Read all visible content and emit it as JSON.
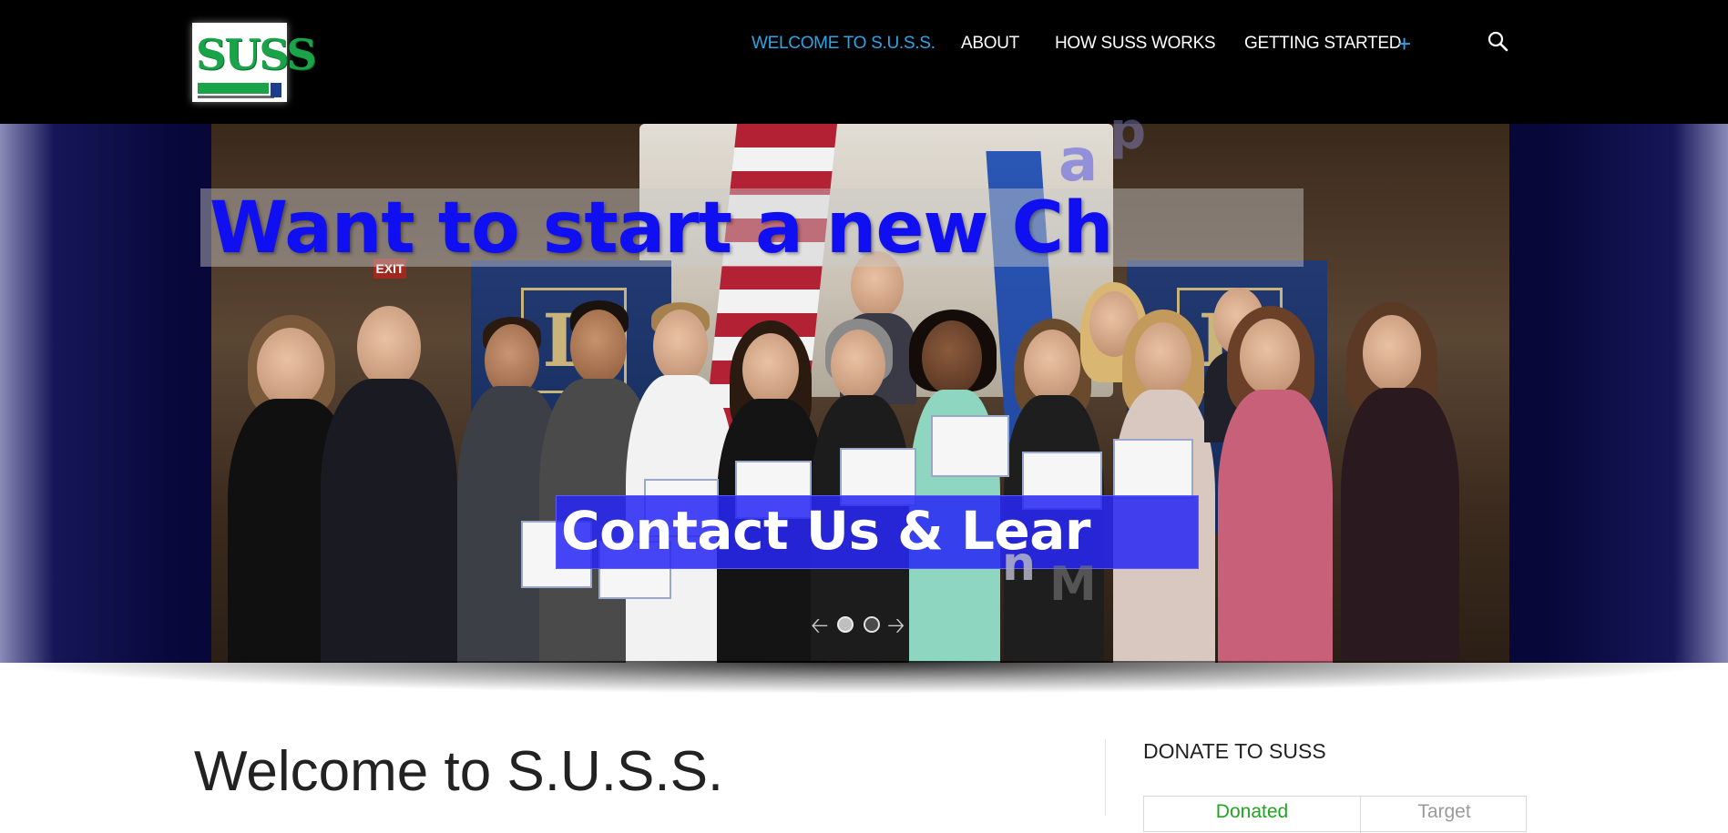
{
  "header": {
    "logo_alt": "SUSS",
    "nav": [
      {
        "label": "WELCOME TO S.U.S.S.",
        "active": true
      },
      {
        "label": "ABOUT",
        "active": false
      },
      {
        "label": "HOW SUSS WORKS",
        "active": false
      },
      {
        "label": "GETTING STARTED",
        "active": false,
        "has_submenu": true
      }
    ],
    "submenu_icon": "+",
    "search_icon": "search-icon"
  },
  "slider": {
    "heading_visible": "Want to start a new Ch",
    "heading_flying_letters": [
      "a",
      "p"
    ],
    "button_visible": "Contact Us & Lear",
    "button_flying_letters": [
      "n",
      "M"
    ],
    "exit_sign": "EXIT",
    "dots_count": 2,
    "active_dot": 2,
    "colors": {
      "heading": "#0f0ff2",
      "button_bg": "#2828f5"
    }
  },
  "main": {
    "title": "Welcome to S.U.S.S."
  },
  "sidebar": {
    "widget_title": "DONATE TO SUSS",
    "columns": [
      "Donated",
      "Target"
    ]
  }
}
